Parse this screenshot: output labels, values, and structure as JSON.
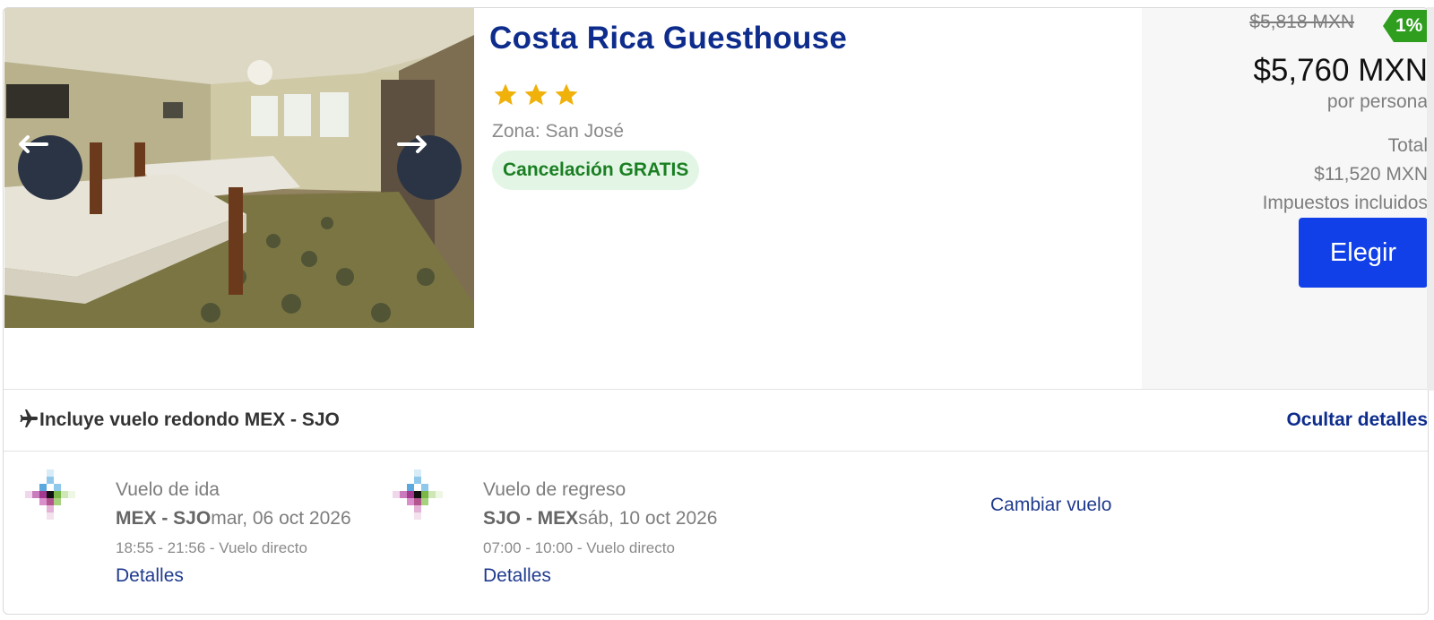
{
  "hotel": {
    "name": "Costa Rica Guesthouse",
    "stars": 3,
    "zone": "Zona: San José",
    "cancellation": "Cancelación GRATIS",
    "photo_alt": ""
  },
  "pricing": {
    "old_price": "$5,818 MXN",
    "discount": "1%",
    "price": "$5,760 MXN",
    "per_person": "por persona",
    "total_label": "Total",
    "total_value": "$11,520 MXN",
    "taxes": "Impuestos incluidos",
    "choose_label": "Elegir"
  },
  "flight": {
    "includes": "Incluye vuelo redondo MEX - SJO",
    "hide_details": "Ocultar detalles",
    "change_flight": "Cambiar vuelo",
    "outbound": {
      "type": "Vuelo de ida",
      "route": "MEX - SJO",
      "date": "mar, 06 oct 2026",
      "time": "18:55 - 21:56 - Vuelo directo",
      "details": "Detalles"
    },
    "return": {
      "type": "Vuelo de regreso",
      "route": "SJO - MEX",
      "date": "sáb, 10 oct 2026",
      "time": "07:00 - 10:00 - Vuelo directo",
      "details": "Detalles"
    }
  },
  "colors": {
    "title": "#0d2c8c",
    "primary_button": "#1240e8",
    "discount_badge": "#2f9e1e",
    "cancel_text": "#1a7f22",
    "star": "#f0b10a"
  },
  "icons": {
    "prev": "arrow-left-icon",
    "next": "arrow-right-icon",
    "star": "star-icon",
    "plane": "airplane-icon",
    "airline": "airline-logo-icon"
  }
}
